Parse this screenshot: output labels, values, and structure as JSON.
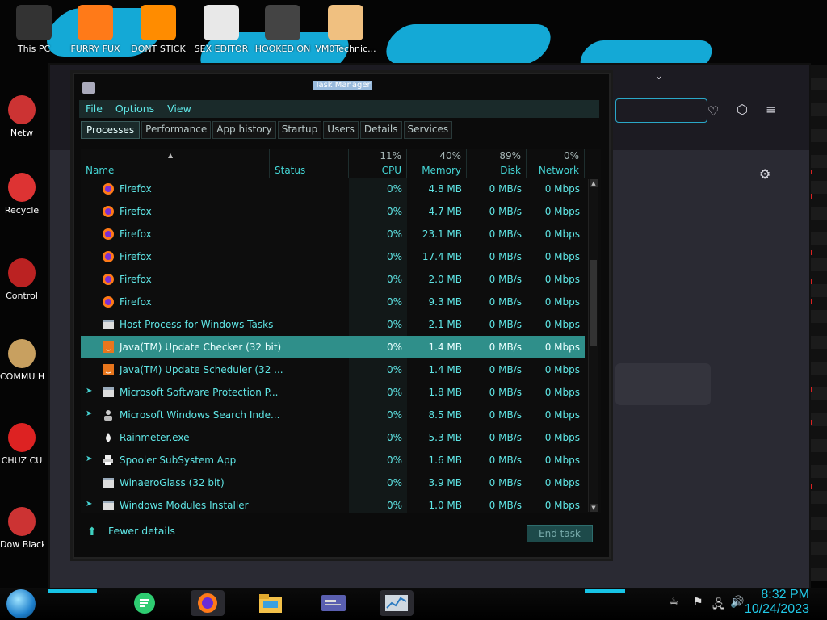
{
  "desktop": {
    "icons": [
      {
        "label": "This PC",
        "icon": "computer-icon"
      },
      {
        "label": "FURRY FUX",
        "icon": "firefox-icon"
      },
      {
        "label": "DONT STICK",
        "icon": "vlc-icon"
      },
      {
        "label": "SEX EDITOR",
        "icon": "adobe-xd-icon"
      },
      {
        "label": "HOOKED ON",
        "icon": "app-icon"
      },
      {
        "label": "VM0Technic...",
        "icon": "doctor-icon"
      }
    ],
    "side_icons": [
      {
        "label": "Netw",
        "icon": "network-icon"
      },
      {
        "label": "Recycle",
        "icon": "recycle-bin-icon"
      },
      {
        "label": "Control",
        "icon": "control-panel-icon"
      },
      {
        "label": "COMMU HATE TH",
        "icon": "money-bag-icon"
      },
      {
        "label": "CHUZ CU",
        "icon": "red-app-icon"
      },
      {
        "label": "Dow Black",
        "icon": "download-icon"
      }
    ]
  },
  "window": {
    "title": "Task Manager",
    "menu": [
      "File",
      "Options",
      "View"
    ],
    "tabs": [
      "Processes",
      "Performance",
      "App history",
      "Startup",
      "Users",
      "Details",
      "Services"
    ],
    "active_tab": "Processes",
    "columns": {
      "name": "Name",
      "status": "Status",
      "cpu": {
        "pct": "11%",
        "label": "CPU"
      },
      "memory": {
        "pct": "40%",
        "label": "Memory"
      },
      "disk": {
        "pct": "89%",
        "label": "Disk"
      },
      "network": {
        "pct": "0%",
        "label": "Network"
      }
    },
    "rows": [
      {
        "name": "Firefox",
        "icon": "firefox",
        "expandable": false,
        "cpu": "0%",
        "memory": "4.8 MB",
        "disk": "0 MB/s",
        "network": "0 Mbps"
      },
      {
        "name": "Firefox",
        "icon": "firefox",
        "expandable": false,
        "cpu": "0%",
        "memory": "4.7 MB",
        "disk": "0 MB/s",
        "network": "0 Mbps"
      },
      {
        "name": "Firefox",
        "icon": "firefox",
        "expandable": false,
        "cpu": "0%",
        "memory": "23.1 MB",
        "disk": "0 MB/s",
        "network": "0 Mbps"
      },
      {
        "name": "Firefox",
        "icon": "firefox",
        "expandable": false,
        "cpu": "0%",
        "memory": "17.4 MB",
        "disk": "0 MB/s",
        "network": "0 Mbps"
      },
      {
        "name": "Firefox",
        "icon": "firefox",
        "expandable": false,
        "cpu": "0%",
        "memory": "2.0 MB",
        "disk": "0 MB/s",
        "network": "0 Mbps"
      },
      {
        "name": "Firefox",
        "icon": "firefox",
        "expandable": false,
        "cpu": "0%",
        "memory": "9.3 MB",
        "disk": "0 MB/s",
        "network": "0 Mbps"
      },
      {
        "name": "Host Process for Windows Tasks",
        "icon": "window",
        "expandable": false,
        "cpu": "0%",
        "memory": "2.1 MB",
        "disk": "0 MB/s",
        "network": "0 Mbps"
      },
      {
        "name": "Java(TM) Update Checker (32 bit)",
        "icon": "java",
        "expandable": false,
        "selected": true,
        "cpu": "0%",
        "memory": "1.4 MB",
        "disk": "0 MB/s",
        "network": "0 Mbps"
      },
      {
        "name": "Java(TM) Update Scheduler (32 ...",
        "icon": "java",
        "expandable": false,
        "cpu": "0%",
        "memory": "1.4 MB",
        "disk": "0 MB/s",
        "network": "0 Mbps"
      },
      {
        "name": "Microsoft Software Protection P...",
        "icon": "window",
        "expandable": true,
        "cpu": "0%",
        "memory": "1.8 MB",
        "disk": "0 MB/s",
        "network": "0 Mbps"
      },
      {
        "name": "Microsoft Windows Search Inde...",
        "icon": "user",
        "expandable": true,
        "cpu": "0%",
        "memory": "8.5 MB",
        "disk": "0 MB/s",
        "network": "0 Mbps"
      },
      {
        "name": "Rainmeter.exe",
        "icon": "drop",
        "expandable": false,
        "cpu": "0%",
        "memory": "5.3 MB",
        "disk": "0 MB/s",
        "network": "0 Mbps"
      },
      {
        "name": "Spooler SubSystem App",
        "icon": "printer",
        "expandable": true,
        "cpu": "0%",
        "memory": "1.6 MB",
        "disk": "0 MB/s",
        "network": "0 Mbps"
      },
      {
        "name": "WinaeroGlass (32 bit)",
        "icon": "window",
        "expandable": false,
        "cpu": "0%",
        "memory": "3.9 MB",
        "disk": "0 MB/s",
        "network": "0 Mbps"
      },
      {
        "name": "Windows Modules Installer",
        "icon": "window",
        "expandable": true,
        "cpu": "0%",
        "memory": "1.0 MB",
        "disk": "0 MB/s",
        "network": "0 Mbps"
      }
    ],
    "fewer_details": "Fewer details",
    "end_task": "End task"
  },
  "taskbar": {
    "apps": [
      "notes-icon",
      "firefox-icon",
      "file-explorer-icon",
      "card-app-icon",
      "task-manager-icon"
    ],
    "time": "8:32 PM",
    "date": "10/24/2023"
  },
  "colors": {
    "accent": "#5fe6e6",
    "selected_row": "#2f8f8a",
    "clock": "#21c8e6"
  }
}
